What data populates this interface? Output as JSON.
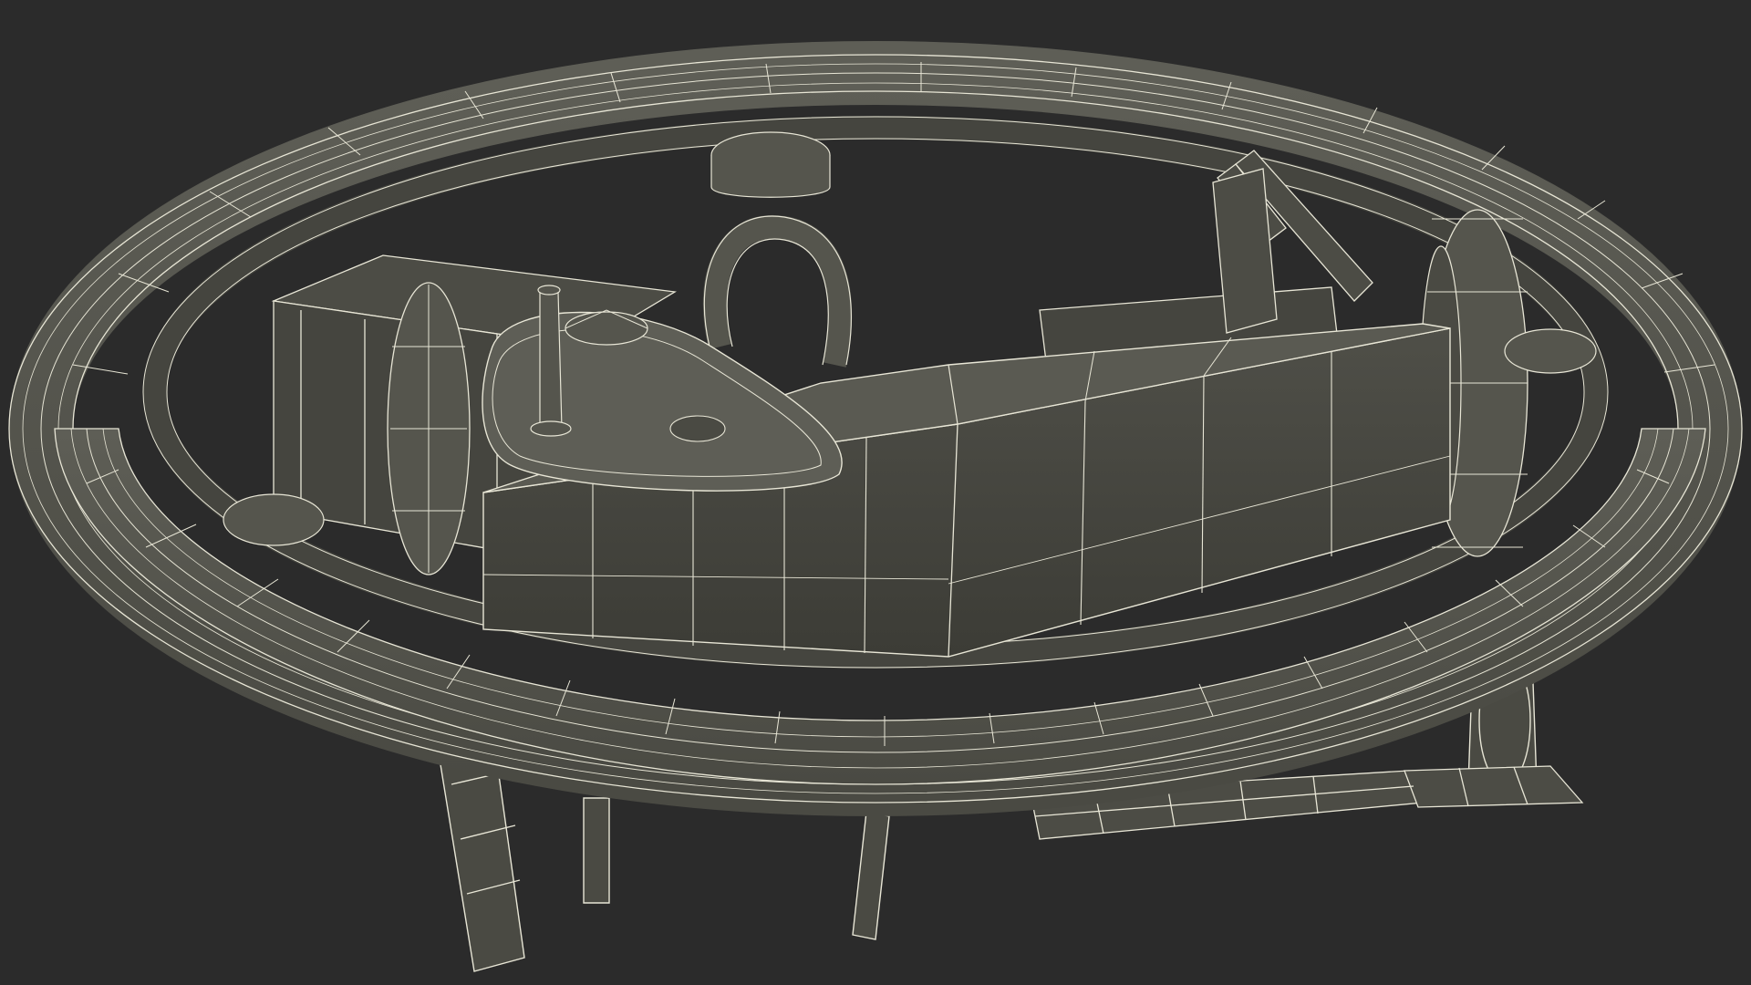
{
  "scene": {
    "background_color": "#2b2b2b",
    "surface_color": "#55554d",
    "surface_dark_color": "#3d3d37",
    "wire_color": "#e8e6d6",
    "subject": "wireframe-3d-model"
  }
}
